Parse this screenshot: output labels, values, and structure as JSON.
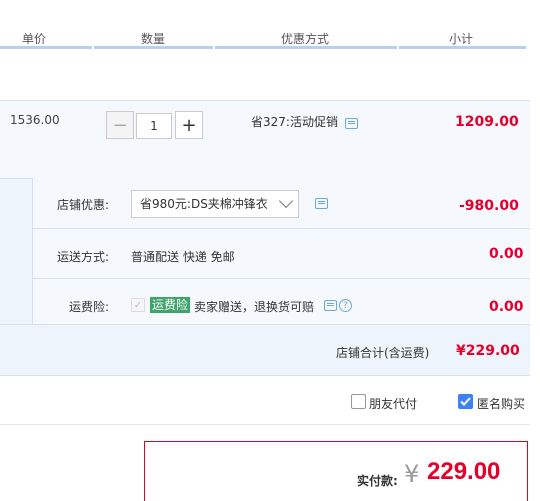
{
  "header": {
    "unit_price": "单价",
    "quantity": "数量",
    "discount": "优惠方式",
    "subtotal": "小计"
  },
  "item": {
    "price": "1536.00",
    "quantity_value": "1",
    "minus": "−",
    "plus": "+",
    "promo": "省327:活动促销",
    "subtotal": "1209.00"
  },
  "shop": {
    "coupon_label": "店铺优惠:",
    "coupon_selected": "省980元:DS夹棉冲锋衣",
    "coupon_amount": "-980.00",
    "shipping_label": "运送方式:",
    "shipping_value": "普通配送 快递 免邮",
    "shipping_amount": "0.00",
    "insurance_label": "运费险:",
    "insurance_badge": "运费险",
    "insurance_desc": "卖家赠送，退换货可赔",
    "insurance_amount": "0.00",
    "total_label": "店铺合计(含运费)",
    "total_amount": "¥229.00"
  },
  "options": {
    "friend_pay": "朋友代付",
    "anonymous": "匿名购买",
    "anonymous_checked": true
  },
  "payment": {
    "label": "实付款:",
    "currency": "¥",
    "amount": "229.00"
  },
  "colors": {
    "accent_red": "#e4002b",
    "row_bg": "#f5f8fc",
    "header_line": "#b7d0ee",
    "badge_green": "#3fa36b"
  }
}
